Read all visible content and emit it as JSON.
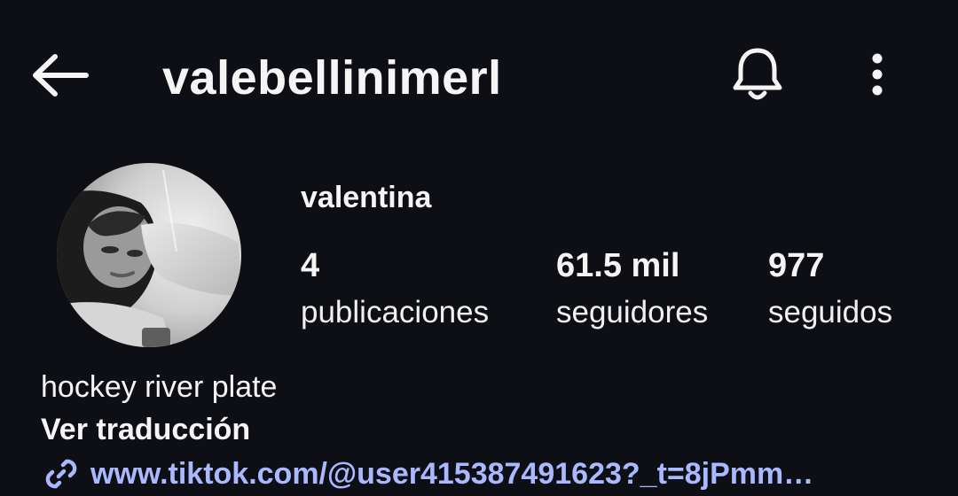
{
  "header": {
    "username": "valebellinimerl",
    "back_icon": "arrow-left-icon",
    "notify_icon": "bell-icon",
    "more_icon": "more-vertical-icon"
  },
  "profile": {
    "display_name": "valentina",
    "avatar_icon": "profile-photo",
    "stats": [
      {
        "value": "4",
        "label": "publicaciones"
      },
      {
        "value": "61.5 mil",
        "label": "seguidores"
      },
      {
        "value": "977",
        "label": "seguidos"
      }
    ],
    "bio": "hockey river plate",
    "translate_label": "Ver traducción",
    "link_icon": "link-icon",
    "link_text": "www.tiktok.com/@user415387491623?_t=8jPmm…"
  },
  "colors": {
    "background": "#0d0f14",
    "text": "#f5f5f5",
    "link": "#a9b8ff"
  }
}
